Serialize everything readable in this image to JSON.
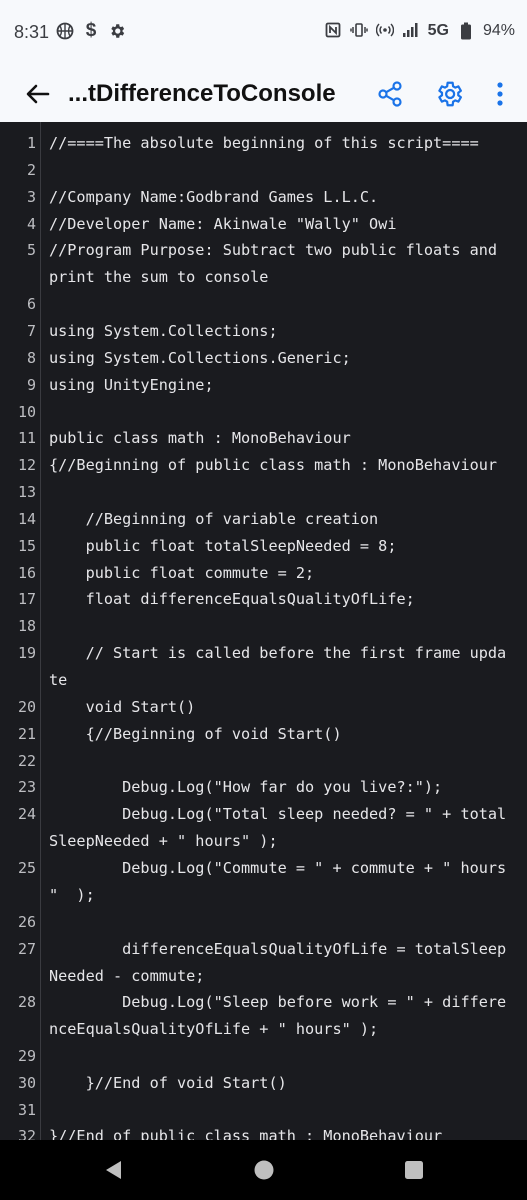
{
  "status_bar": {
    "time": "8:31",
    "network": "5G",
    "battery": "94%",
    "left_icons": [
      "basketball-icon",
      "dollar-icon",
      "gear-icon"
    ],
    "right_icons": [
      "nfc-icon",
      "vibrate-icon",
      "hotspot-icon",
      "signal-icon",
      "battery-icon"
    ]
  },
  "app_bar": {
    "title": "...tDifferenceToConsole",
    "back_icon": "arrow-left-icon",
    "share_icon": "share-icon",
    "settings_icon": "gear-icon",
    "more_icon": "more-vertical-icon",
    "accent_color": "#1a73e8"
  },
  "editor": {
    "lines": [
      {
        "n": "1",
        "t": "//====The absolute beginning of this script===="
      },
      {
        "n": "2",
        "t": ""
      },
      {
        "n": "3",
        "t": "//Company Name:Godbrand Games L.L.C."
      },
      {
        "n": "4",
        "t": "//Developer Name: Akinwale \"Wally\" Owi"
      },
      {
        "n": "5",
        "t": "//Program Purpose: Subtract two public floats and\nprint the sum to console"
      },
      {
        "n": "6",
        "t": ""
      },
      {
        "n": "7",
        "t": "using System.Collections;"
      },
      {
        "n": "8",
        "t": "using System.Collections.Generic;"
      },
      {
        "n": "9",
        "t": "using UnityEngine;"
      },
      {
        "n": "10",
        "t": ""
      },
      {
        "n": "11",
        "t": "public class math : MonoBehaviour"
      },
      {
        "n": "12",
        "t": "{//Beginning of public class math : MonoBehaviour"
      },
      {
        "n": "13",
        "t": ""
      },
      {
        "n": "14",
        "t": "    //Beginning of variable creation"
      },
      {
        "n": "15",
        "t": "    public float totalSleepNeeded = 8;"
      },
      {
        "n": "16",
        "t": "    public float commute = 2;"
      },
      {
        "n": "17",
        "t": "    float differenceEqualsQualityOfLife;"
      },
      {
        "n": "18",
        "t": ""
      },
      {
        "n": "19",
        "t": "    // Start is called before the first frame upda\nte"
      },
      {
        "n": "20",
        "t": "    void Start()"
      },
      {
        "n": "21",
        "t": "    {//Beginning of void Start()"
      },
      {
        "n": "22",
        "t": ""
      },
      {
        "n": "23",
        "t": "        Debug.Log(\"How far do you live?:\");"
      },
      {
        "n": "24",
        "t": "        Debug.Log(\"Total sleep needed? = \" + total\nSleepNeeded + \" hours\" );"
      },
      {
        "n": "25",
        "t": "        Debug.Log(\"Commute = \" + commute + \" hours\n\"  );"
      },
      {
        "n": "26",
        "t": ""
      },
      {
        "n": "27",
        "t": "        differenceEqualsQualityOfLife = totalSleep\nNeeded - commute;"
      },
      {
        "n": "28",
        "t": "        Debug.Log(\"Sleep before work = \" + differe\nnceEqualsQualityOfLife + \" hours\" );"
      },
      {
        "n": "29",
        "t": ""
      },
      {
        "n": "30",
        "t": "    }//End of void Start()"
      },
      {
        "n": "31",
        "t": ""
      },
      {
        "n": "32",
        "t": "}//End of public class math : MonoBehaviour"
      }
    ]
  },
  "nav_bar": {
    "back_icon": "nav-back-triangle-icon",
    "home_icon": "nav-home-circle-icon",
    "recents_icon": "nav-recents-square-icon"
  }
}
